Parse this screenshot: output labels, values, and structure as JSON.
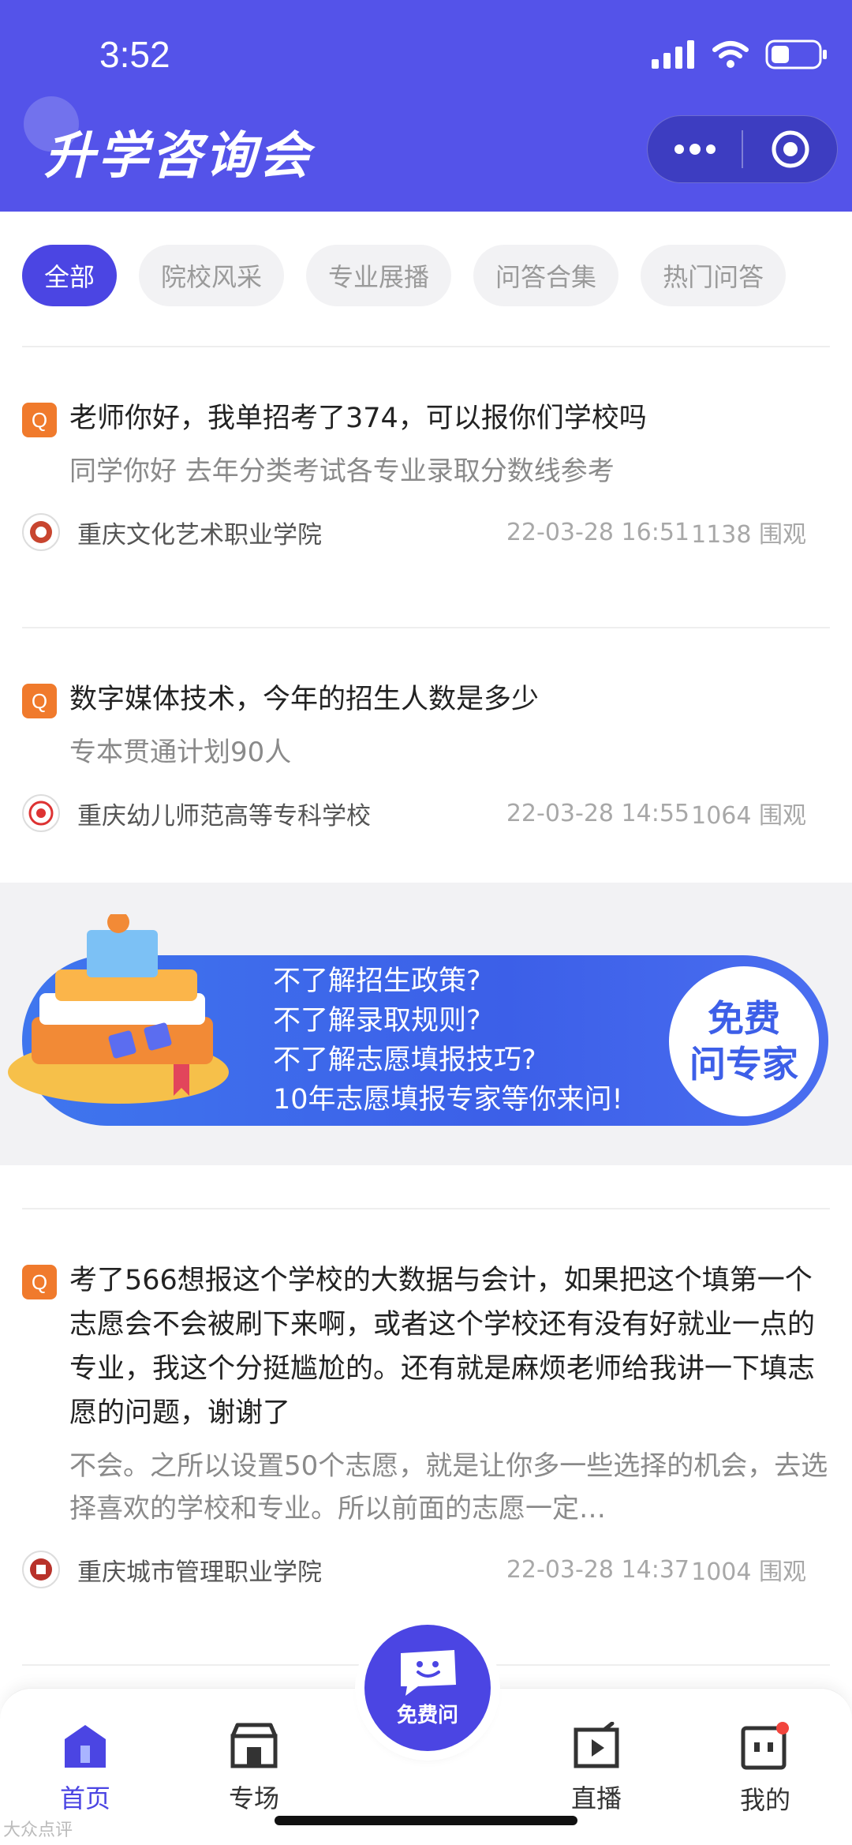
{
  "status_bar": {
    "time": "3:52"
  },
  "header": {
    "title": "升学咨询会"
  },
  "tabs": [
    {
      "label": "全部",
      "active": true
    },
    {
      "label": "院校风采",
      "active": false
    },
    {
      "label": "专业展播",
      "active": false
    },
    {
      "label": "问答合集",
      "active": false
    },
    {
      "label": "热门问答",
      "active": false
    }
  ],
  "qa_items": [
    {
      "badge": "Q",
      "question": "老师你好，我单招考了374，可以报你们学校吗",
      "answer": "同学你好 去年分类考试各专业录取分数线参考",
      "school": "重庆文化艺术职业学院",
      "time": "22-03-28 16:51",
      "views": "1138 围观"
    },
    {
      "badge": "Q",
      "question": "数字媒体技术，今年的招生人数是多少",
      "answer": "专本贯通计划90人",
      "school": "重庆幼儿师范高等专科学校",
      "time": "22-03-28 14:55",
      "views": "1064 围观"
    },
    {
      "badge": "Q",
      "question": "考了566想报这个学校的大数据与会计，如果把这个填第一个志愿会不会被刷下来啊，或者这个学校还有没有好就业一点的专业，我这个分挺尴尬的。还有就是麻烦老师给我讲一下填志愿的问题，谢谢了",
      "answer": "不会。之所以设置50个志愿，就是让你多一些选择的机会，去选择喜欢的学校和专业。所以前面的志愿一定…",
      "school": "重庆城市管理职业学院",
      "time": "22-03-28 14:37",
      "views": "1004 围观"
    }
  ],
  "banner": {
    "lines": [
      "不了解招生政策?",
      "不了解录取规则?",
      "不了解志愿填报技巧?",
      "10年志愿填报专家等你来问!"
    ],
    "badge_line1": "免费",
    "badge_line2": "问专家"
  },
  "bottom_nav": {
    "items": [
      {
        "label": "首页",
        "icon": "home-icon",
        "active": true
      },
      {
        "label": "专场",
        "icon": "store-icon",
        "active": false
      },
      {
        "label": "直播",
        "icon": "play-icon",
        "active": false
      },
      {
        "label": "我的",
        "icon": "profile-icon",
        "active": false
      }
    ],
    "fab_label": "免费问"
  },
  "watermark": "大众点评",
  "colors": {
    "primary": "#4b45e3",
    "header": "#5453e9",
    "q_badge": "#f07a2c"
  }
}
